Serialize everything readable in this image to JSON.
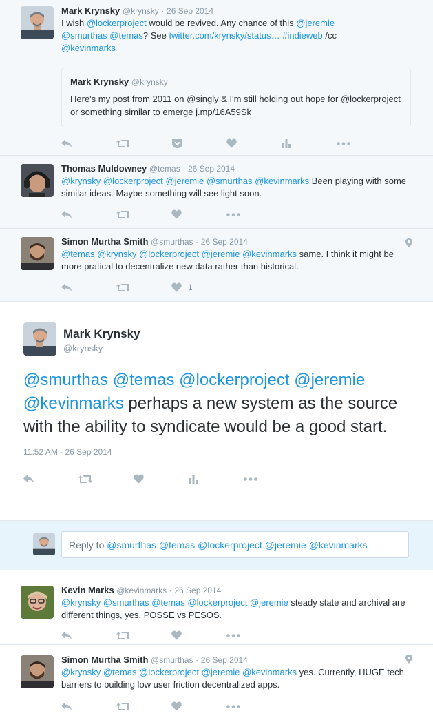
{
  "tweets_before": [
    {
      "name": "Mark Krynsky",
      "handle": "@krynsky",
      "date": "26 Sep 2014",
      "text_parts": [
        "I wish ",
        "@lockerproject",
        " would be revived. Any chance of this ",
        "@jeremie",
        " ",
        "@smurthas",
        " ",
        "@temas",
        "? See ",
        "twitter.com/krynsky/status…",
        " ",
        "#indieweb",
        " /cc ",
        "@kevinmarks"
      ],
      "quote": {
        "name": "Mark Krynsky",
        "handle": "@krynsky",
        "text": "Here's my post from 2011 on @singly & I'm still holding out hope for @lockerproject or something similar to emerge j.mp/16A59Sk"
      }
    },
    {
      "name": "Thomas Muldowney",
      "handle": "@temas",
      "date": "26 Sep 2014",
      "text_parts": [
        "@krynsky",
        " ",
        "@lockerproject",
        " ",
        "@jeremie",
        " ",
        "@smurthas",
        " ",
        "@kevinmarks",
        " Been playing with some similar ideas. Maybe something will see light soon."
      ]
    },
    {
      "name": "Simon Murtha Smith",
      "handle": "@smurthas",
      "date": "26 Sep 2014",
      "text_parts": [
        "@temas",
        " ",
        "@krynsky",
        " ",
        "@lockerproject",
        " ",
        "@jeremie",
        " ",
        "@kevinmarks",
        " same. I think it might be more pratical to decentralize new data rather than historical."
      ],
      "like_count": "1"
    }
  ],
  "main_tweet": {
    "name": "Mark Krynsky",
    "handle": "@krynsky",
    "text_parts": [
      "@smurthas",
      " ",
      "@temas",
      " ",
      "@lockerproject",
      " ",
      "@jeremie",
      " ",
      "@kevinmarks",
      " perhaps a new system as the source with the ability to syndicate would be a good start."
    ],
    "timestamp": "11:52 AM - 26 Sep 2014"
  },
  "reply_box": {
    "prefix": "Reply to ",
    "mentions": "@smurthas @temas @lockerproject @jeremie @kevinmarks"
  },
  "tweets_after": [
    {
      "name": "Kevin Marks",
      "handle": "@kevinmarks",
      "date": "26 Sep 2014",
      "text_parts": [
        "@krynsky",
        " ",
        "@smurthas",
        " ",
        "@temas",
        " ",
        "@lockerproject",
        " ",
        "@jeremie",
        " steady state and archival are different things, yes. POSSE vs PESOS."
      ]
    },
    {
      "name": "Simon Murtha Smith",
      "handle": "@smurthas",
      "date": "26 Sep 2014",
      "text_parts": [
        "@krynsky",
        " ",
        "@temas",
        " ",
        "@lockerproject",
        " ",
        "@jeremie",
        " ",
        "@kevinmarks",
        " yes. Currently, HUGE tech barriers to building low user friction decentralized apps."
      ]
    }
  ],
  "separator": "·",
  "colors": {
    "link": "#1b95e0",
    "text": "#292f33",
    "muted": "#8899a6",
    "icon": "#aab8c2",
    "ancestor_bg": "#f5f8fa",
    "reply_bg": "#e8f4fb"
  },
  "icons": [
    "reply-icon",
    "retweet-icon",
    "pocket-icon",
    "like-icon",
    "analytics-icon",
    "more-icon",
    "location-pin-icon"
  ]
}
